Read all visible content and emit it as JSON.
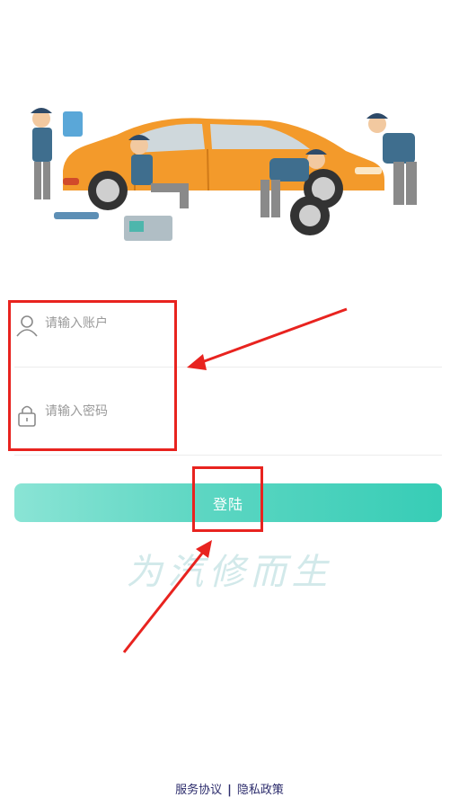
{
  "login": {
    "account_placeholder": "请输入账户",
    "password_placeholder": "请输入密码",
    "button_label": "登陆"
  },
  "slogan": "为汽修而生",
  "footer": {
    "service_agreement": "服务协议",
    "separator": "|",
    "privacy_policy": "隐私政策"
  },
  "icons": {
    "account": "user-icon",
    "password": "lock-icon"
  },
  "colors": {
    "accent_start": "#8ae4d5",
    "accent_end": "#37cdb6",
    "car_body": "#f39a2b",
    "mechanic_shirt": "#3f6e8e",
    "annotation": "#e8231f",
    "footer_link": "#2c2c6c"
  }
}
